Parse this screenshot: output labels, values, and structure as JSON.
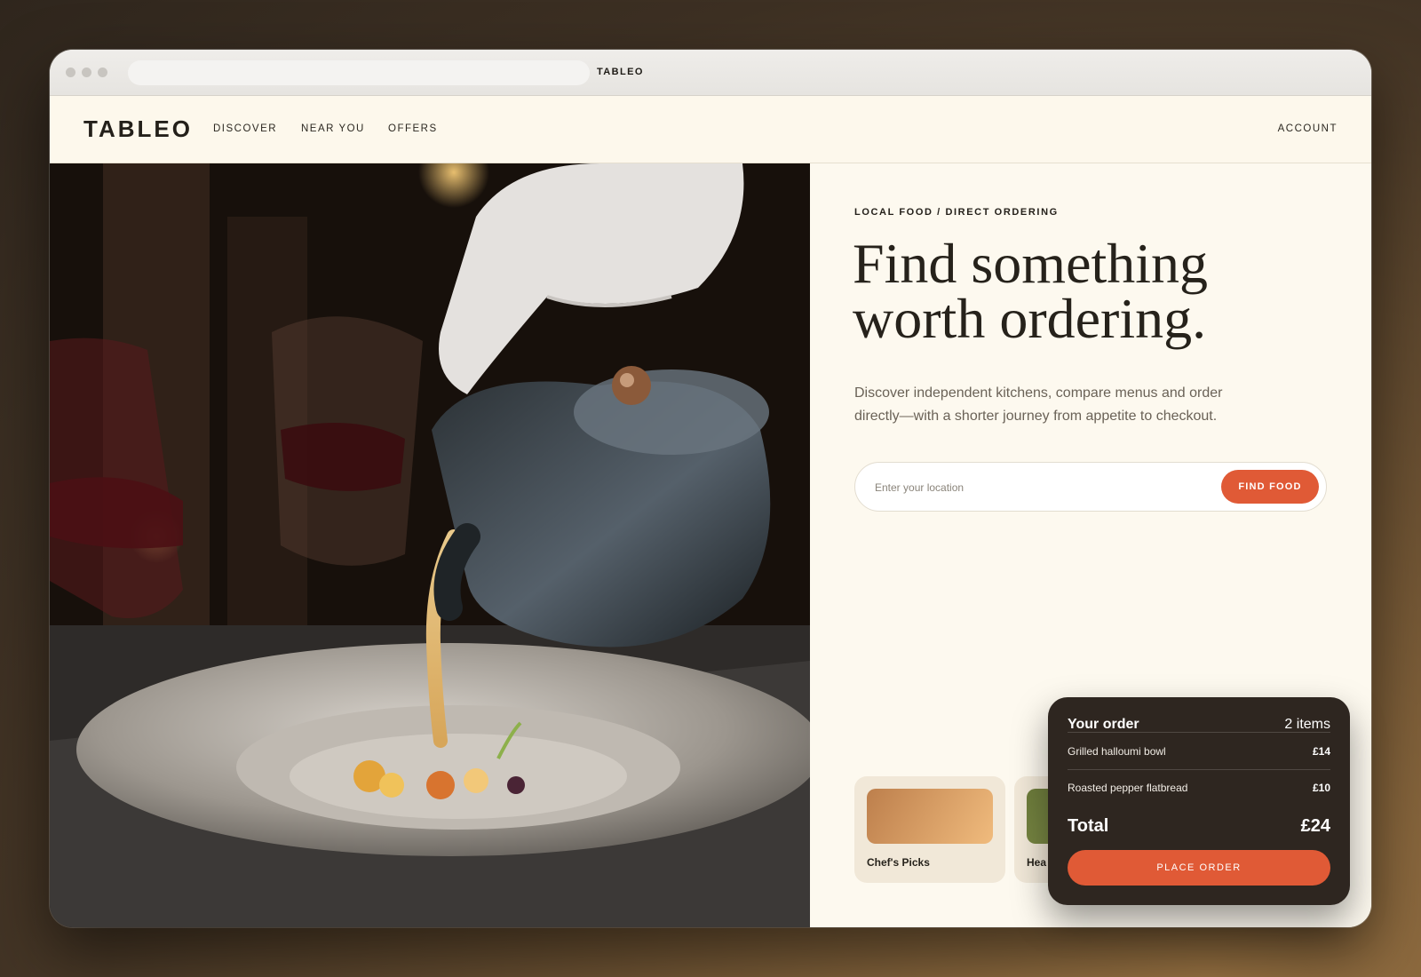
{
  "browser": {
    "tab_title": "TABLEO"
  },
  "nav": {
    "logo": "TABLEO",
    "links": [
      "DISCOVER",
      "NEAR YOU",
      "OFFERS"
    ],
    "account": "ACCOUNT"
  },
  "hero": {
    "eyebrow": "LOCAL FOOD / DIRECT ORDERING",
    "headline_line1": "Find something",
    "headline_line2": "worth ordering.",
    "subtext": "Discover independent kitchens, compare menus and order directly—with a shorter journey from appetite to checkout.",
    "search_placeholder": "Enter your location",
    "search_button": "FIND FOOD"
  },
  "categories": [
    {
      "label": "Chef's Picks",
      "color": "#d29a67"
    },
    {
      "label": "Hea",
      "color": "#7c8a45"
    }
  ],
  "order": {
    "title": "Your order",
    "count": "2 items",
    "items": [
      {
        "name": "Grilled halloumi bowl",
        "price": "£14"
      },
      {
        "name": "Roasted pepper flatbread",
        "price": "£10"
      }
    ],
    "total_label": "Total",
    "total_value": "£24",
    "button": "PLACE ORDER"
  },
  "colors": {
    "accent": "#e05a36",
    "background": "#fdf9ef",
    "order_panel": "#2e2620"
  }
}
